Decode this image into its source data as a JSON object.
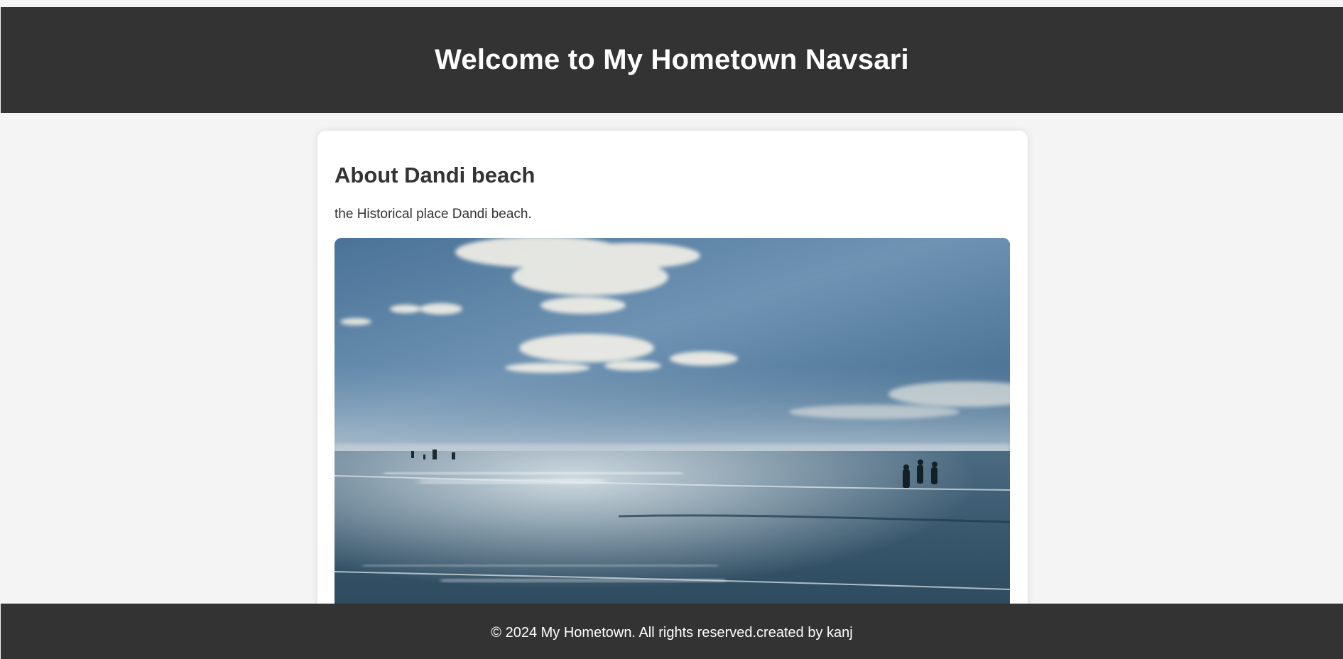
{
  "header": {
    "title": "Welcome to My Hometown Navsari"
  },
  "section": {
    "heading": "About Dandi beach",
    "description": "the Historical place Dandi beach.",
    "image": {
      "subject": "dandi-beach-photo",
      "sky_color": "#3f6a8f",
      "sea_color": "#2e4a5e"
    }
  },
  "footer": {
    "text": "© 2024 My Hometown. All rights reserved.created by kanj"
  },
  "colors": {
    "header_bg": "#333333",
    "page_bg": "#f4f4f4",
    "card_bg": "#ffffff",
    "text": "#333333"
  }
}
